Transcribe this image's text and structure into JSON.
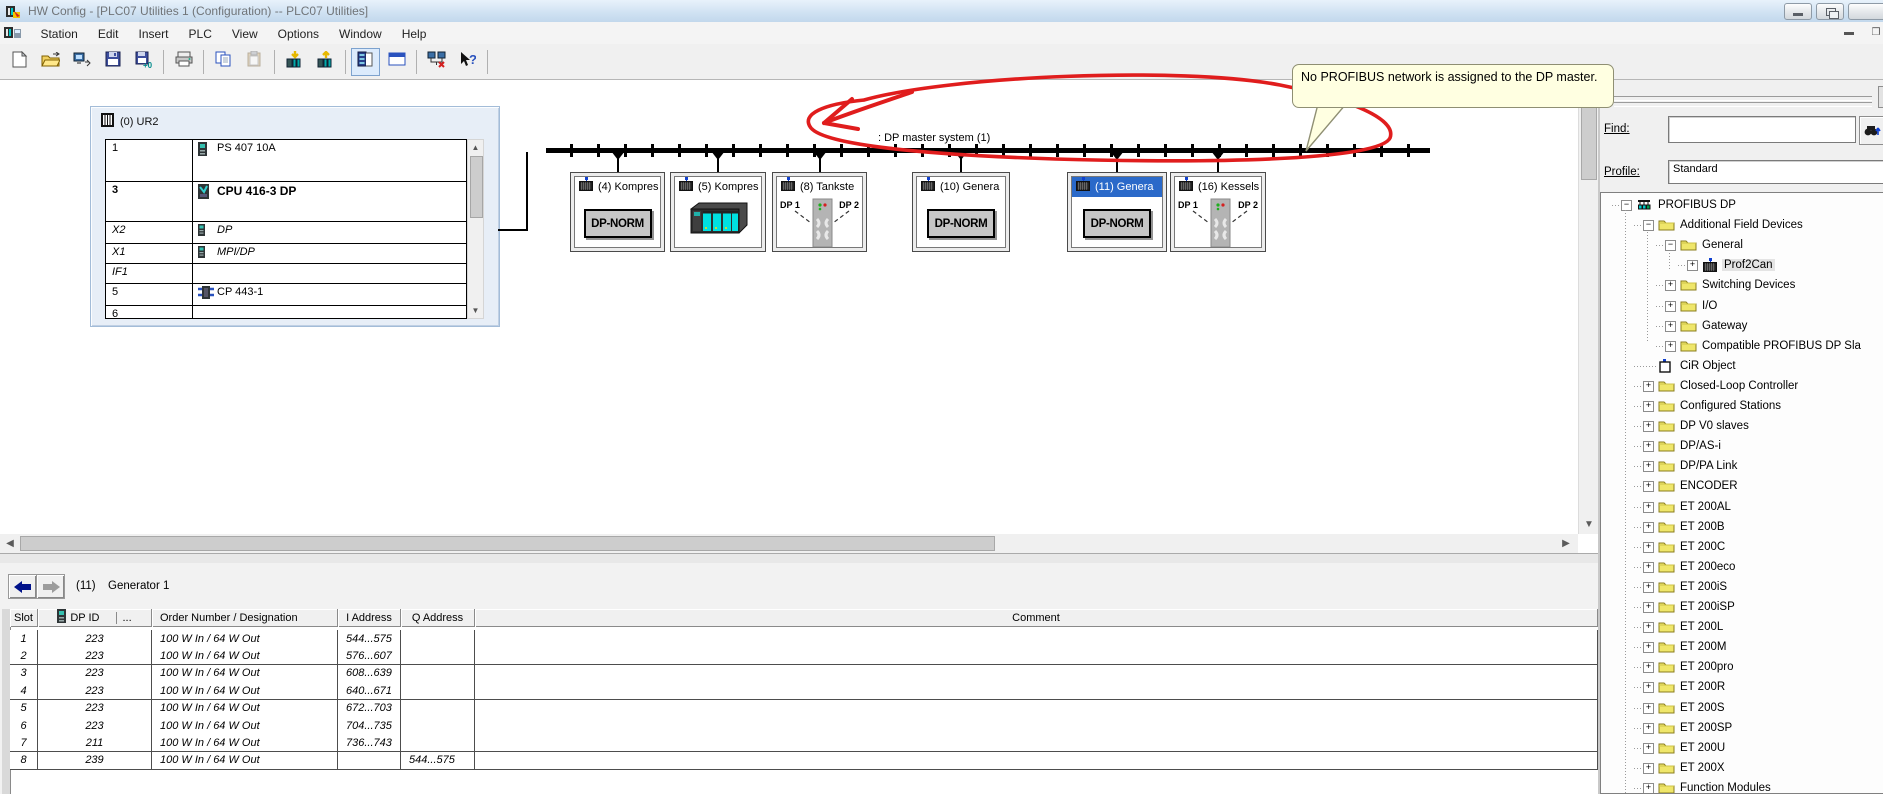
{
  "window": {
    "title": "HW Config - [PLC07 Utilities 1 (Configuration) -- PLC07 Utilities]"
  },
  "menu": {
    "items": [
      "Station",
      "Edit",
      "Insert",
      "PLC",
      "View",
      "Options",
      "Window",
      "Help"
    ]
  },
  "toolbar": {
    "buttons": [
      {
        "name": "new-station"
      },
      {
        "name": "open-station"
      },
      {
        "name": "open-online"
      },
      {
        "name": "save"
      },
      {
        "name": "save-and-compile"
      },
      {
        "sep": true
      },
      {
        "name": "print"
      },
      {
        "sep": true
      },
      {
        "name": "copy"
      },
      {
        "name": "paste",
        "disabled": true
      },
      {
        "sep": true
      },
      {
        "name": "download-to-module"
      },
      {
        "name": "upload-from-module"
      },
      {
        "sep": true
      },
      {
        "name": "catalog-toggle",
        "pressed": true
      },
      {
        "name": "address-overview"
      },
      {
        "sep": true
      },
      {
        "name": "configure-network"
      },
      {
        "name": "help"
      },
      {
        "sep": true
      }
    ]
  },
  "canvas": {
    "rack": {
      "title": "(0) UR2",
      "rows": [
        {
          "slot": "1",
          "name": "PS 407 10A",
          "icon": "ps-module-icon",
          "bold": false,
          "italic": false
        },
        {
          "slot": "3",
          "name": "CPU 416-3 DP",
          "icon": "cpu-module-icon",
          "bold": true,
          "italic": false
        },
        {
          "slot": "X2",
          "name": "DP",
          "icon": "if-module-icon",
          "bold": false,
          "italic": true
        },
        {
          "slot": "X1",
          "name": "MPI/DP",
          "icon": "if-module-icon",
          "bold": false,
          "italic": true
        },
        {
          "slot": "IF1",
          "name": "",
          "icon": "",
          "bold": false,
          "italic": true
        },
        {
          "slot": "5",
          "name": "CP 443-1",
          "icon": "cp-module-icon",
          "bold": false,
          "italic": false
        },
        {
          "slot": "6",
          "name": "",
          "icon": "",
          "bold": false,
          "italic": false
        }
      ]
    },
    "bus_label": ": DP master system (1)",
    "devices": [
      {
        "label": "(4) Kompres",
        "content": "dp-norm",
        "badge": "DP-NORM",
        "selected": false
      },
      {
        "label": "(5) Kompres",
        "content": "rack-image",
        "selected": false
      },
      {
        "label": "(8) Tankste",
        "content": "dp-ports",
        "ports": [
          "DP 1",
          "DP 2"
        ],
        "selected": false
      },
      {
        "label": "(10) Genera",
        "content": "dp-norm",
        "badge": "DP-NORM",
        "selected": false
      },
      {
        "label": "(11) Genera",
        "content": "dp-norm",
        "badge": "DP-NORM",
        "selected": true
      },
      {
        "label": "(16) Kessels",
        "content": "dp-ports",
        "ports": [
          "DP 1",
          "DP 2"
        ],
        "selected": false
      }
    ],
    "tooltip": {
      "text": "No PROFIBUS network is assigned to the DP master."
    }
  },
  "catalog": {
    "find_label": "Find:",
    "find_value": "",
    "profile_label": "Profile:",
    "profile_value": "Standard",
    "tree": [
      {
        "label": "PROFIBUS DP",
        "level": 0,
        "expand": "minus",
        "icon": "profibus-net",
        "selected": false
      },
      {
        "label": "Additional Field Devices",
        "level": 1,
        "expand": "minus",
        "icon": "folder",
        "selected": false
      },
      {
        "label": "General",
        "level": 2,
        "expand": "minus",
        "icon": "folder",
        "selected": false
      },
      {
        "label": "Prof2Can",
        "level": 3,
        "expand": "plus",
        "icon": "dp-slave",
        "selected": true
      },
      {
        "label": "Switching Devices",
        "level": 2,
        "expand": "plus",
        "icon": "folder",
        "selected": false
      },
      {
        "label": "I/O",
        "level": 2,
        "expand": "plus",
        "icon": "folder",
        "selected": false
      },
      {
        "label": "Gateway",
        "level": 2,
        "expand": "plus",
        "icon": "folder",
        "selected": false
      },
      {
        "label": "Compatible PROFIBUS DP Sla",
        "level": 2,
        "expand": "plus",
        "icon": "folder",
        "selected": false
      },
      {
        "label": "CiR Object",
        "level": 1,
        "expand": "none",
        "icon": "cir-object",
        "selected": false
      },
      {
        "label": "Closed-Loop Controller",
        "level": 1,
        "expand": "plus",
        "icon": "folder",
        "selected": false
      },
      {
        "label": "Configured Stations",
        "level": 1,
        "expand": "plus",
        "icon": "folder",
        "selected": false
      },
      {
        "label": "DP V0 slaves",
        "level": 1,
        "expand": "plus",
        "icon": "folder",
        "selected": false
      },
      {
        "label": "DP/AS-i",
        "level": 1,
        "expand": "plus",
        "icon": "folder",
        "selected": false
      },
      {
        "label": "DP/PA Link",
        "level": 1,
        "expand": "plus",
        "icon": "folder",
        "selected": false
      },
      {
        "label": "ENCODER",
        "level": 1,
        "expand": "plus",
        "icon": "folder",
        "selected": false
      },
      {
        "label": "ET 200AL",
        "level": 1,
        "expand": "plus",
        "icon": "folder",
        "selected": false
      },
      {
        "label": "ET 200B",
        "level": 1,
        "expand": "plus",
        "icon": "folder",
        "selected": false
      },
      {
        "label": "ET 200C",
        "level": 1,
        "expand": "plus",
        "icon": "folder",
        "selected": false
      },
      {
        "label": "ET 200eco",
        "level": 1,
        "expand": "plus",
        "icon": "folder",
        "selected": false
      },
      {
        "label": "ET 200iS",
        "level": 1,
        "expand": "plus",
        "icon": "folder",
        "selected": false
      },
      {
        "label": "ET 200iSP",
        "level": 1,
        "expand": "plus",
        "icon": "folder",
        "selected": false
      },
      {
        "label": "ET 200L",
        "level": 1,
        "expand": "plus",
        "icon": "folder",
        "selected": false
      },
      {
        "label": "ET 200M",
        "level": 1,
        "expand": "plus",
        "icon": "folder",
        "selected": false
      },
      {
        "label": "ET 200pro",
        "level": 1,
        "expand": "plus",
        "icon": "folder",
        "selected": false
      },
      {
        "label": "ET 200R",
        "level": 1,
        "expand": "plus",
        "icon": "folder",
        "selected": false
      },
      {
        "label": "ET 200S",
        "level": 1,
        "expand": "plus",
        "icon": "folder",
        "selected": false
      },
      {
        "label": "ET 200SP",
        "level": 1,
        "expand": "plus",
        "icon": "folder",
        "selected": false
      },
      {
        "label": "ET 200U",
        "level": 1,
        "expand": "plus",
        "icon": "folder",
        "selected": false
      },
      {
        "label": "ET 200X",
        "level": 1,
        "expand": "plus",
        "icon": "folder",
        "selected": false
      },
      {
        "label": "Function Modules",
        "level": 1,
        "expand": "plus",
        "icon": "folder",
        "selected": false
      }
    ]
  },
  "detail": {
    "station_no": "(11)",
    "station_name": "Generator 1",
    "columns": [
      "Slot",
      "DP ID",
      "...",
      "Order Number / Designation",
      "I Address",
      "Q Address",
      "Comment"
    ],
    "rows": [
      [
        "1",
        "223",
        "100 W In / 64 W Out",
        "544...575",
        "",
        ""
      ],
      [
        "2",
        "223",
        "100 W In / 64 W Out",
        "576...607",
        "",
        ""
      ],
      [
        "3",
        "223",
        "100 W In / 64 W Out",
        "608...639",
        "",
        ""
      ],
      [
        "4",
        "223",
        "100 W In / 64 W Out",
        "640...671",
        "",
        ""
      ],
      [
        "5",
        "223",
        "100 W In / 64 W Out",
        "672...703",
        "",
        ""
      ],
      [
        "6",
        "223",
        "100 W In / 64 W Out",
        "704...735",
        "",
        ""
      ],
      [
        "7",
        "211",
        "100 W In / 64 W Out",
        "736...743",
        "",
        ""
      ],
      [
        "8",
        "239",
        "100 W In / 64 W Out",
        "",
        "544...575",
        ""
      ]
    ]
  },
  "colors": {
    "selection_blue": "#2a69c9",
    "tooltip_bg": "#ffffe1",
    "annotation_red": "#e01d1d",
    "bus_black": "#000000"
  }
}
